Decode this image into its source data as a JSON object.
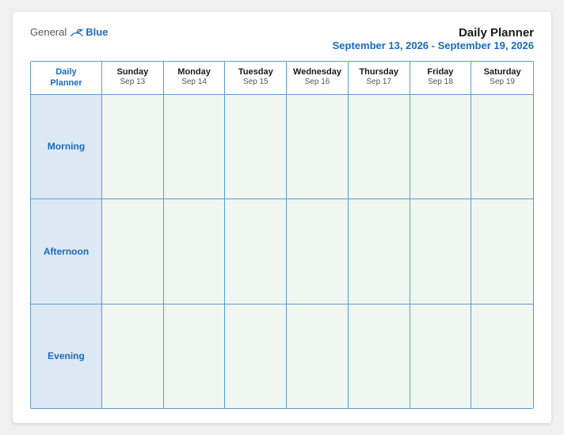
{
  "logo": {
    "general": "General",
    "blue": "Blue",
    "tagline": ""
  },
  "title": {
    "main": "Daily Planner",
    "sub": "September 13, 2026 - September 19, 2026"
  },
  "columns": [
    {
      "id": "label",
      "day": "Daily",
      "day2": "Planner",
      "date": ""
    },
    {
      "id": "sun",
      "day": "Sunday",
      "date": "Sep 13"
    },
    {
      "id": "mon",
      "day": "Monday",
      "date": "Sep 14"
    },
    {
      "id": "tue",
      "day": "Tuesday",
      "date": "Sep 15"
    },
    {
      "id": "wed",
      "day": "Wednesday",
      "date": "Sep 16"
    },
    {
      "id": "thu",
      "day": "Thursday",
      "date": "Sep 17"
    },
    {
      "id": "fri",
      "day": "Friday",
      "date": "Sep 18"
    },
    {
      "id": "sat",
      "day": "Saturday",
      "date": "Sep 19"
    }
  ],
  "rows": [
    {
      "label": "Morning"
    },
    {
      "label": "Afternoon"
    },
    {
      "label": "Evening"
    }
  ]
}
